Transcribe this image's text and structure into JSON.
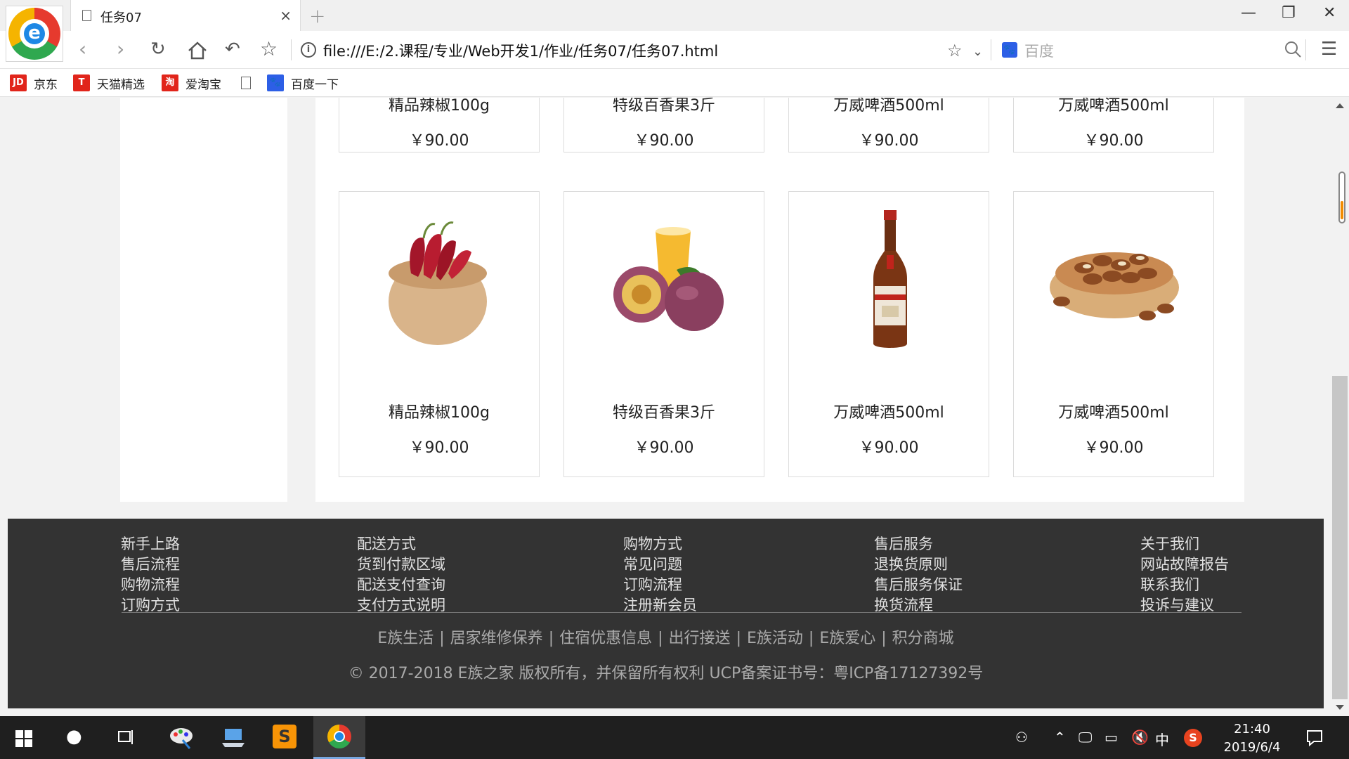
{
  "browser": {
    "tab_title": "任务07",
    "tab_close": "×",
    "new_tab": "+",
    "url": "file:///E:/2.课程/专业/Web开发1/作业/任务07/任务07.html",
    "search_placeholder": "百度",
    "window_controls": {
      "minimize": "—",
      "restore": "❐",
      "close": "✕"
    },
    "nav_icons": [
      "back-icon",
      "forward-icon",
      "reload-icon",
      "home-icon",
      "undo-icon",
      "star-icon"
    ]
  },
  "bookmarks": [
    {
      "label": "京东",
      "badge": "JD",
      "color": "#e1251b"
    },
    {
      "label": "天猫精选",
      "badge": "T",
      "color": "#e1251b"
    },
    {
      "label": "爱淘宝",
      "badge": "淘",
      "color": "#e1251b"
    },
    {
      "label": "",
      "badge": "",
      "color": ""
    },
    {
      "label": "百度一下",
      "badge": "",
      "color": "#2d5fe6"
    }
  ],
  "products_top_row": [
    {
      "name": "精品辣椒100g",
      "price": "￥90.00"
    },
    {
      "name": "特级百香果3斤",
      "price": "￥90.00"
    },
    {
      "name": "万威啤酒500ml",
      "price": "￥90.00"
    },
    {
      "name": "万威啤酒500ml",
      "price": "￥90.00"
    }
  ],
  "products": [
    {
      "name": "精品辣椒100g",
      "price": "￥90.00",
      "image": "chili-in-bowl"
    },
    {
      "name": "特级百香果3斤",
      "price": "￥90.00",
      "image": "passion-fruit"
    },
    {
      "name": "万威啤酒500ml",
      "price": "￥90.00",
      "image": "beer-bottle"
    },
    {
      "name": "万威啤酒500ml",
      "price": "￥90.00",
      "image": "pine-nuts"
    }
  ],
  "footer": {
    "columns": [
      [
        "新手上路",
        "售后流程",
        "购物流程",
        "订购方式"
      ],
      [
        "配送方式",
        "货到付款区域",
        "配送支付查询",
        "支付方式说明"
      ],
      [
        "购物方式",
        "常见问题",
        "订购流程",
        "注册新会员"
      ],
      [
        "售后服务",
        "退换货原则",
        "售后服务保证",
        "换货流程"
      ],
      [
        "关于我们",
        "网站故障报告",
        "联系我们",
        "投诉与建议"
      ]
    ],
    "links": [
      "E族生活",
      "居家维修保养",
      "住宿优惠信息",
      "出行接送",
      "E族活动",
      "E族爱心",
      "积分商城"
    ],
    "separator": "|",
    "copyright": "© 2017-2018 E族之家 版权所有，并保留所有权利 UCP备案证书号：粤ICP备17127392号"
  },
  "taskbar": {
    "time": "21:40",
    "date": "2019/6/4",
    "ime": "中"
  }
}
